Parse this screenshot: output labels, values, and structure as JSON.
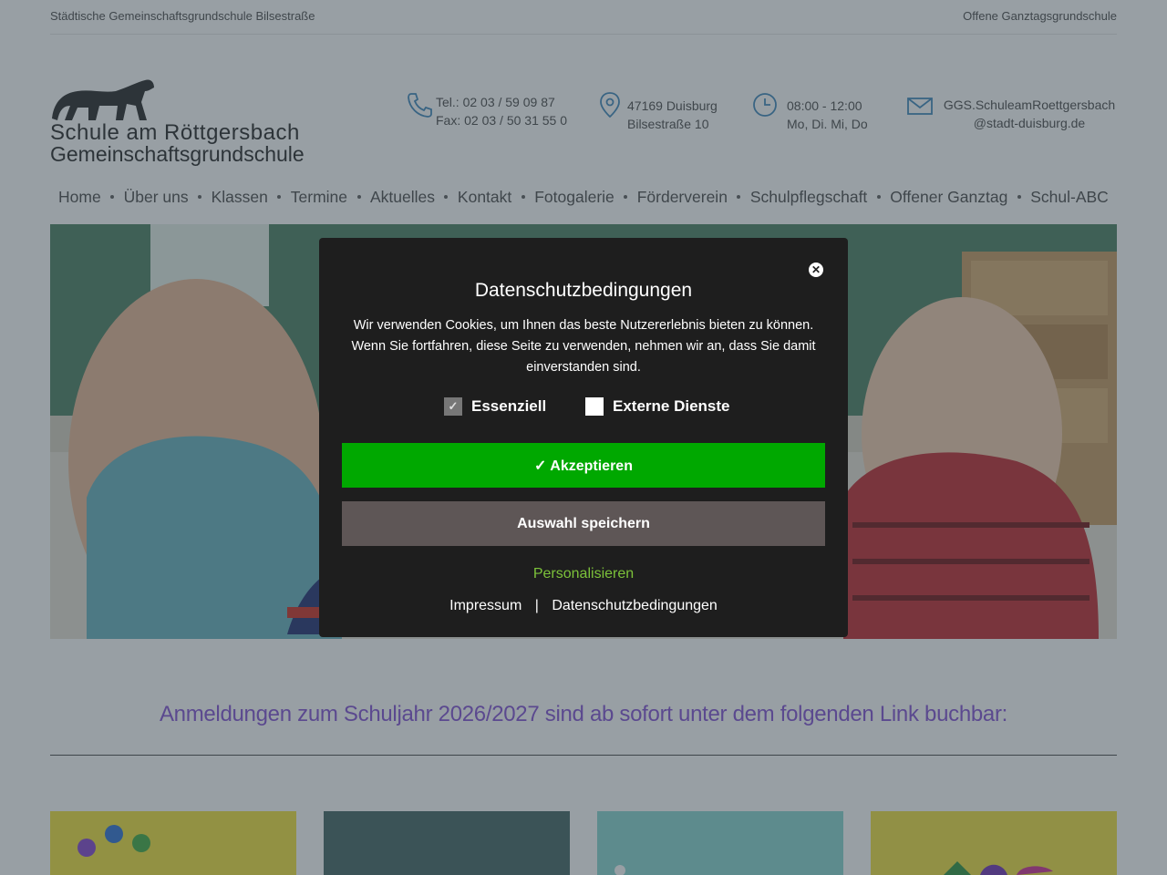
{
  "topbar": {
    "left_text": "Städtische Gemeinschaftsgrundschule Bilsestraße",
    "right_text": "Offene Ganztagsgrundschule"
  },
  "logo": {
    "line1": "Schule am Röttgersbach",
    "line2": "Gemeinschaftsgrundschule"
  },
  "contact": {
    "phone": "Tel.: 02 03 / 59 09 87",
    "fax": "Fax: 02 03 / 50 31 55 0",
    "address_line1": "47169 Duisburg",
    "address_line2": "Bilsestraße 10",
    "hours_line1": "08:00 - 12:00",
    "hours_line2": "Mo, Di. Mi, Do",
    "email_line1": "GGS.SchuleamRoettgersbach",
    "email_line2": "@stadt-duisburg.de"
  },
  "nav": {
    "items": [
      {
        "label": "Home"
      },
      {
        "label": "Über uns"
      },
      {
        "label": "Klassen"
      },
      {
        "label": "Termine"
      },
      {
        "label": "Aktuelles"
      },
      {
        "label": "Kontakt"
      },
      {
        "label": "Fotogalerie"
      },
      {
        "label": "Förderverein"
      },
      {
        "label": "Schulpflegschaft"
      },
      {
        "label": "Offener Ganztag"
      },
      {
        "label": "Schul-ABC"
      }
    ]
  },
  "headline": "Anmeldungen zum Schuljahr 2026/2027 sind ab sofort unter dem folgenden Link buchbar:",
  "modal": {
    "title": "Datenschutzbedingungen",
    "description": "Wir verwenden Cookies, um Ihnen das beste Nutzererlebnis bieten zu können. Wenn Sie fortfahren, diese Seite zu verwenden, nehmen wir an, dass Sie damit einverstanden sind.",
    "check_essential": "Essenziell",
    "check_external": "Externe Dienste",
    "accept_label": "✓ Akzeptieren",
    "save_label": "Auswahl speichern",
    "personalize_label": "Personalisieren",
    "link_imprint": "Impressum",
    "separator": "|",
    "link_privacy": "Datenschutzbedingungen",
    "close_glyph": "✕"
  },
  "colors": {
    "accent_green": "#00a800",
    "save_gray": "#5e5656",
    "headline_purple": "#8a5bd6",
    "personalize_green": "#7cc23a",
    "modal_bg": "#1e1e1e"
  }
}
